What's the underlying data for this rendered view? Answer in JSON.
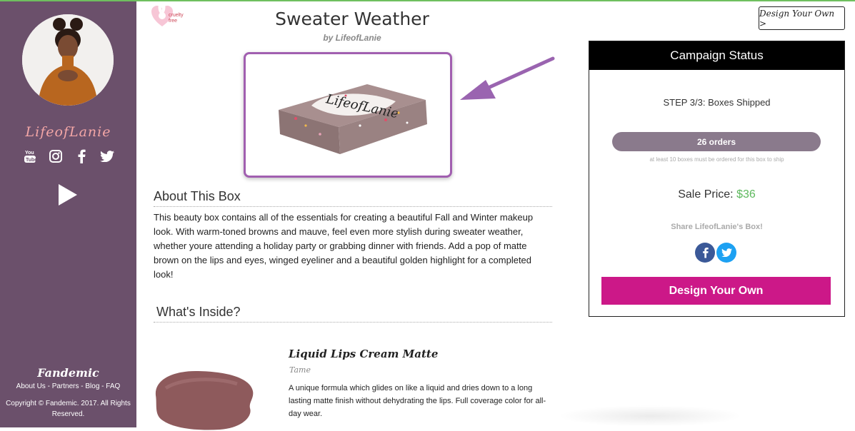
{
  "sidebar": {
    "creator_name": "LifeofLanie",
    "socials": [
      "youtube-icon",
      "instagram-icon",
      "facebook-icon",
      "twitter-icon"
    ],
    "brand": "Fandemic",
    "links": [
      "About Us",
      "Partners",
      "Blog",
      "FAQ"
    ],
    "link_separator": " - ",
    "copyright": "Copyright © Fandemic. 2017. All Rights Reserved."
  },
  "header": {
    "badge_line1": "cruelty",
    "badge_line2": "free",
    "title": "Sweater Weather",
    "byline": "by LifeofLanie",
    "top_button": "Design Your Own >"
  },
  "about": {
    "heading": "About This Box",
    "text": "This beauty box contains all of the essentials for creating a beautiful Fall and Winter makeup look. With warm-toned browns and mauve, feel even more stylish during sweater weather, whether youre attending a holiday party or grabbing dinner with friends. Add a pop of matte brown on the lips and eyes, winged eyeliner and a beautiful golden highlight for a completed look!"
  },
  "inside": {
    "heading": "What's Inside?",
    "products": [
      {
        "name": "Liquid Lips Cream Matte",
        "shade": "Tame",
        "description": "A unique formula which glides on like a liquid and dries down to a long lasting matte finish without dehydrating the lips. Full coverage color for all-day wear."
      }
    ]
  },
  "campaign": {
    "heading": "Campaign Status",
    "step": "STEP 3/3: Boxes Shipped",
    "orders": "26 orders",
    "orders_progress": 1.0,
    "min_note": "at least 10 boxes must be ordered for this box to ship",
    "sale_label": "Sale Price:",
    "sale_price": "$36",
    "share_label": "Share LifeofLanie's Box!",
    "design_button": "Design Your Own"
  },
  "colors": {
    "sidebar": "#6b506b",
    "accent": "#cc1888",
    "price": "#5cb85c",
    "image_border": "#a15fb0"
  }
}
